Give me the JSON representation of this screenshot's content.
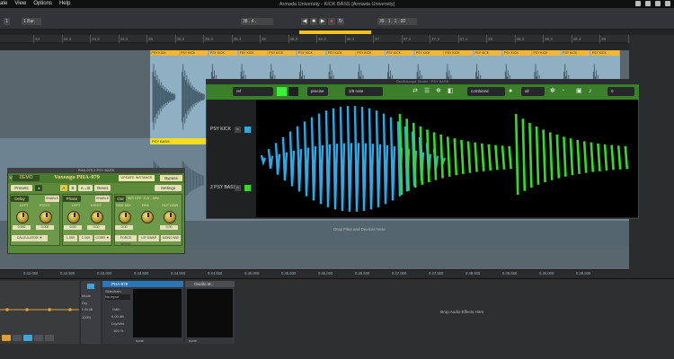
{
  "menubar": {
    "items": [
      "ate",
      "View",
      "Options",
      "Help"
    ]
  },
  "app": {
    "title": "Armada University - KICK BASS [Armada University]",
    "top_left_controls": [
      "1",
      "1 Bar"
    ],
    "tempo_field": "38 . 4 .",
    "position_field": "39 . 1 . 1 . 00"
  },
  "ruler": {
    "ticks": [
      "34",
      "34.2",
      "34.3",
      "34.4",
      "35",
      "35.2",
      "35.3",
      "35.4",
      "36",
      "36.2",
      "36.3",
      "36.4",
      "37",
      "37.2",
      "37.3",
      "37.4",
      "38",
      "38.2",
      "38.3",
      "38.4",
      "39",
      "39.2"
    ]
  },
  "tracks": {
    "kick_clip": "PSY KICK",
    "bass_clip": "PSY BASS",
    "drop_text": "Drop Files and Devices Here"
  },
  "timeaxis": {
    "labels": [
      "0:42.000",
      "0:42.500",
      "0:43.000",
      "0:43.500",
      "0:44.000",
      "0:44.500",
      "0:45.000",
      "0:45.500",
      "0:46.000",
      "0:46.500",
      "0:47.000",
      "0:47.500",
      "0:48.000",
      "0:48.500",
      "0:49.000",
      "0:49.500"
    ]
  },
  "pha": {
    "window_title": "PHA-979 2 PSY BASS",
    "badge": "DEMO",
    "preset_index": "1/3",
    "name": "Voxengo PHA-979",
    "update_label": "UPDATE INSTANCE",
    "bypass_label": "Bypass",
    "presets_label": "Presets",
    "ab_labels": [
      "A",
      "B",
      "A→B"
    ],
    "reset_label": "Reset",
    "settings_label": "Settings",
    "sections": {
      "delay": "Delay",
      "phase": "Phase",
      "out": "Out",
      "enable": "ENABLE"
    },
    "labels": {
      "left": "LEFT",
      "right": "RIGHT",
      "left2": "LEFT",
      "right2": "RIGHT",
      "side_mix": "SIDE MIX",
      "ph_off": "PH OFF",
      "out_gain": "OUT GAIN",
      "pan": "PAN",
      "on": "M/S OFF",
      "d": "D.S",
      "mw": "MW"
    },
    "values": [
      "0.000",
      "0.000",
      "0.00",
      "0.00",
      "0.00",
      "0.00"
    ],
    "boxes": [
      "CALCULATOR ▼",
      "L 000",
      "C 000",
      "CORR ▼",
      "FORCE MONO",
      "L/R SWAP",
      "MONO MIX"
    ]
  },
  "osc": {
    "window_title": "Oscilloscope Studio · PSY BASS",
    "field1": "ref",
    "field2": "precise",
    "field3": "1/8 note",
    "combined": "combined",
    "all": "all",
    "track1": "PSY KICK",
    "track2": "2 PSY BASS",
    "track1_color": "#2aaae6",
    "track2_color": "#30e020",
    "num_field": "0"
  },
  "devices": {
    "dev2_title": "PHA-979",
    "dev2_rows": [
      "Sidechain",
      "No input",
      "Gain",
      "Dry/Wet"
    ],
    "dev2_vals": [
      "0.00 dB",
      "100 %"
    ],
    "dev3_title": "Oscillo M...",
    "none1": "none",
    "none2": "none",
    "drop_fx": "Drop Audio Effects Here",
    "side_vals": [
      "Mode",
      "Dry",
      "0.00 dB",
      "100%"
    ]
  },
  "colors": {
    "kick_wave": "#2aaae6",
    "bass_wave": "#30e020",
    "clip_header": "#f2b632",
    "plugin_green": "#5c8a3a"
  }
}
